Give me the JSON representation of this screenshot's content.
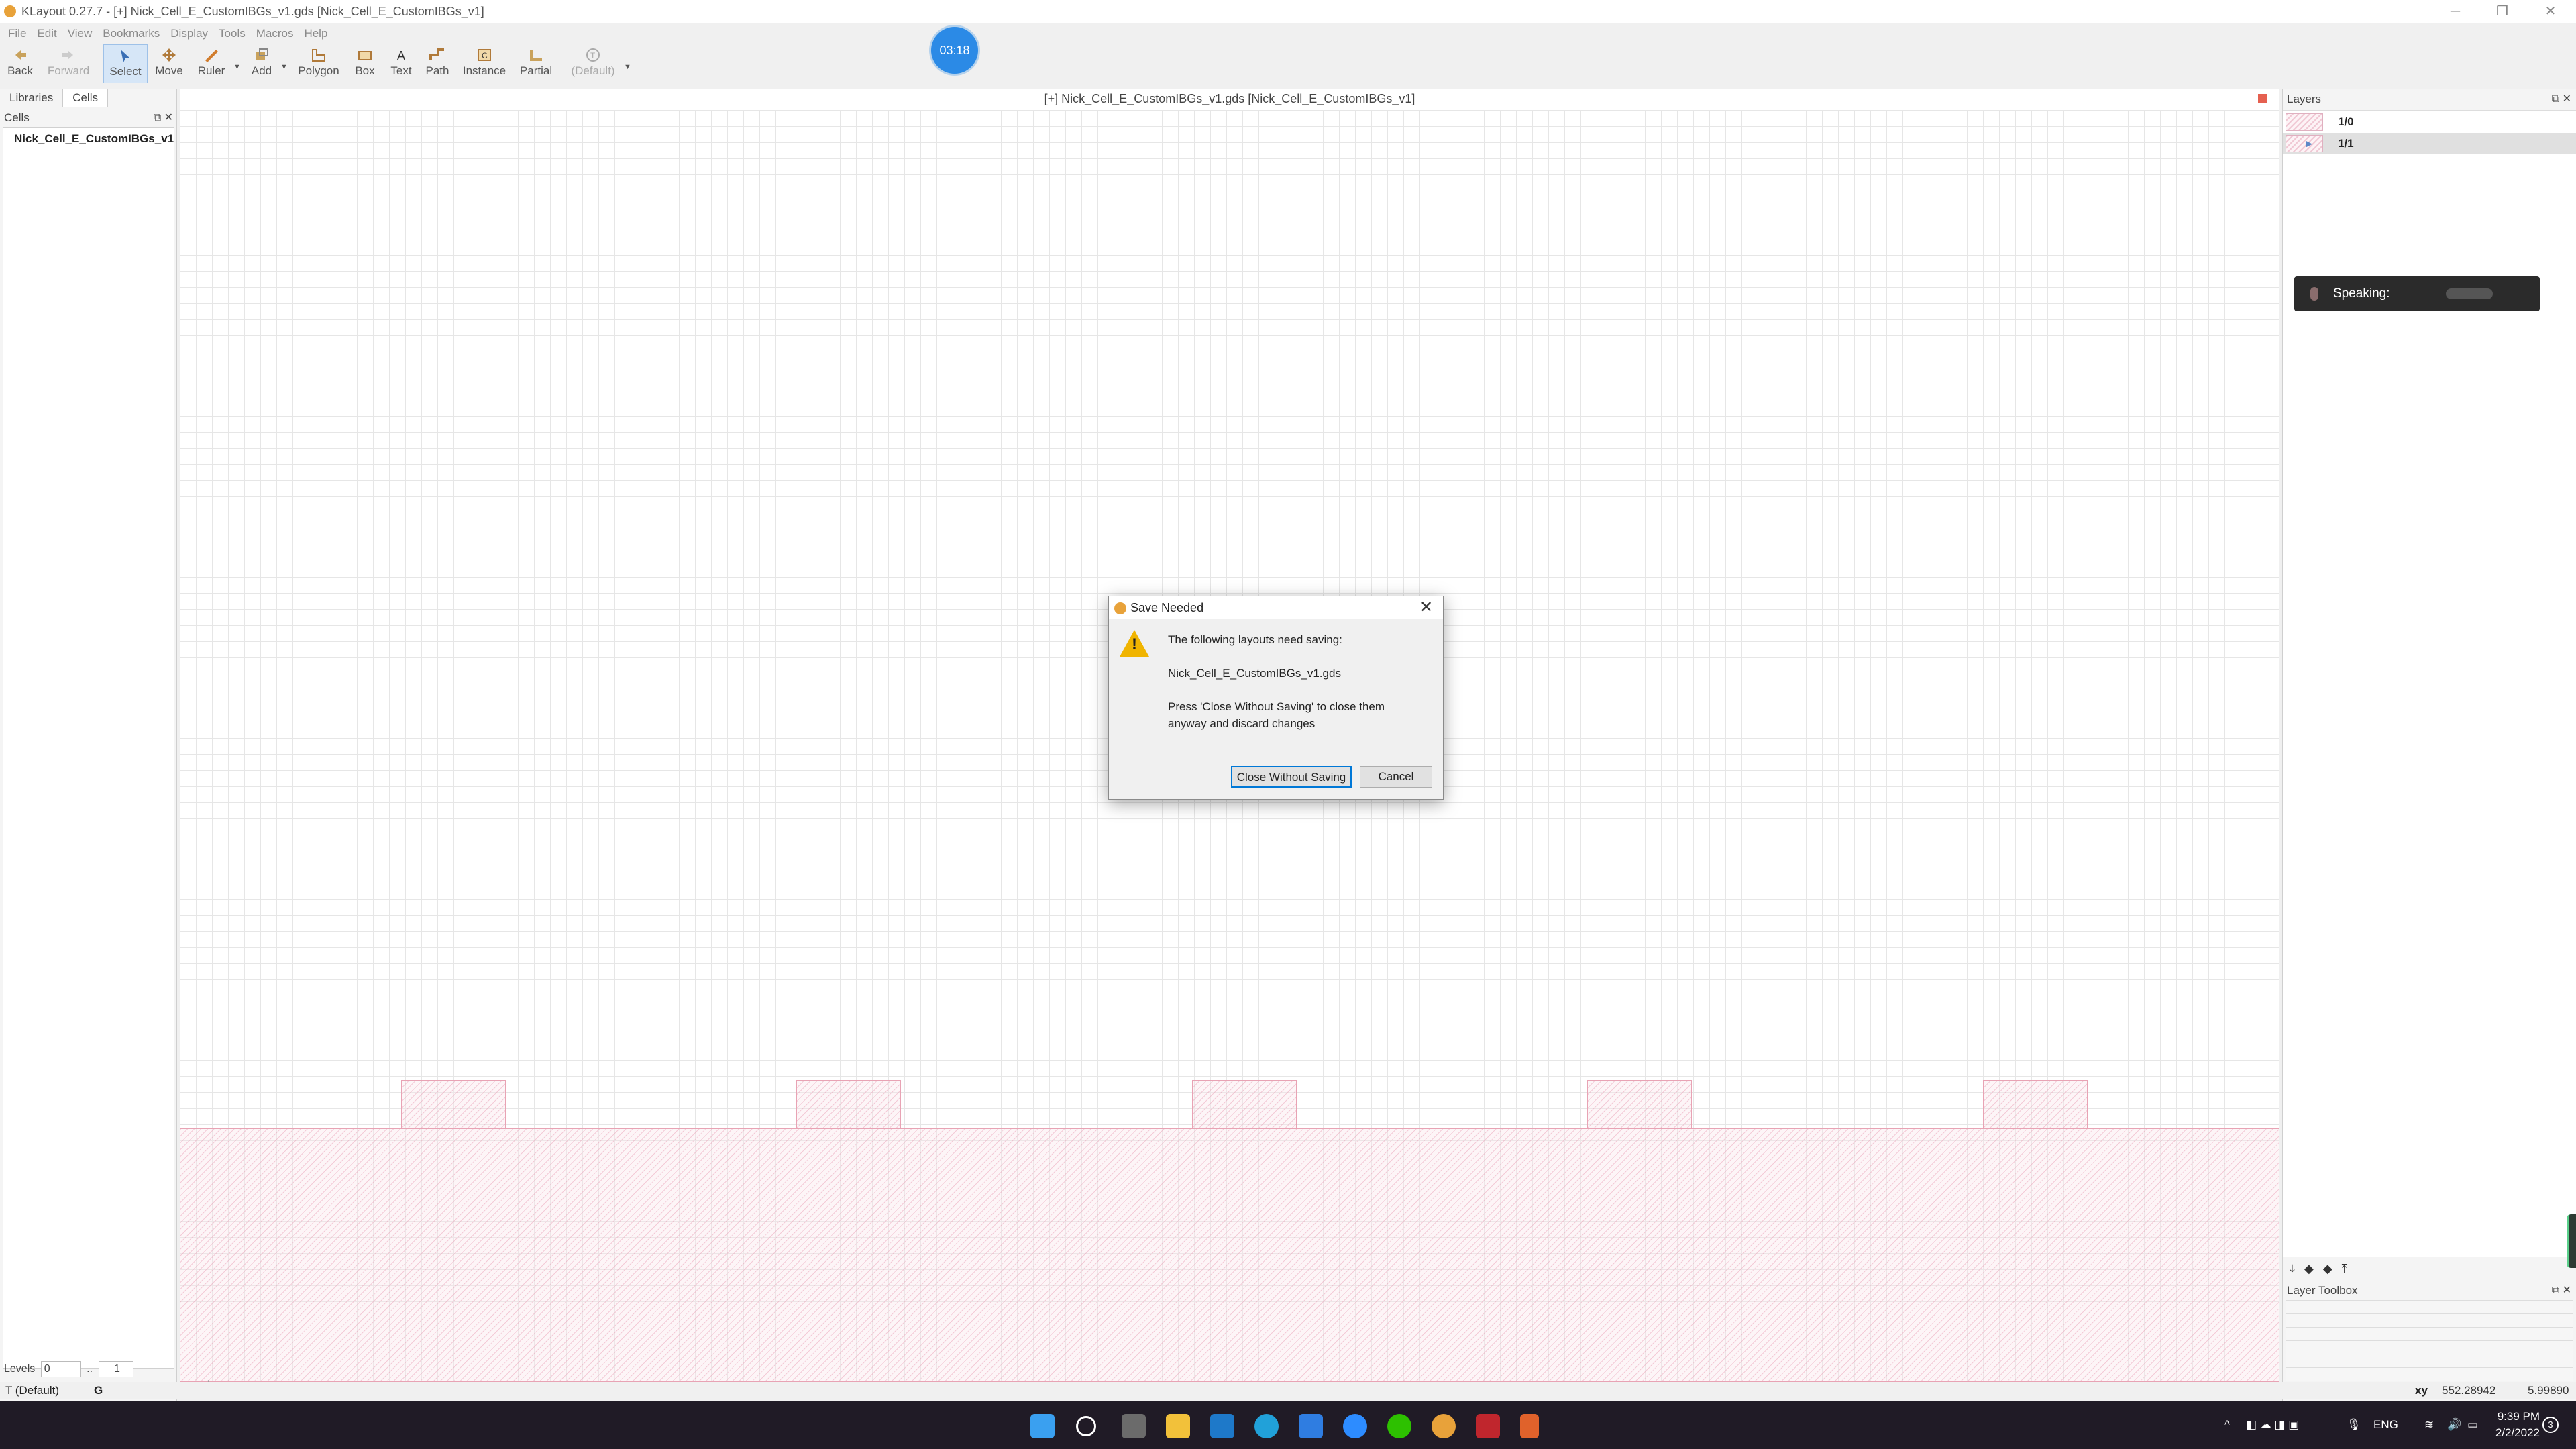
{
  "window": {
    "title": "KLayout 0.27.7 - [+] Nick_Cell_E_CustomIBGs_v1.gds [Nick_Cell_E_CustomIBGs_v1]",
    "minimize": "─",
    "maximize": "❐",
    "close": "✕"
  },
  "menu": [
    "File",
    "Edit",
    "View",
    "Bookmarks",
    "Display",
    "Tools",
    "Macros",
    "Help"
  ],
  "toolbar": {
    "back": "Back",
    "forward": "Forward",
    "select": "Select",
    "move": "Move",
    "ruler": "Ruler",
    "add": "Add",
    "polygon": "Polygon",
    "box": "Box",
    "text": "Text",
    "path": "Path",
    "instance": "Instance",
    "partial": "Partial",
    "default": "(Default)"
  },
  "timer": "03:18",
  "left_panel": {
    "tabs": [
      "Libraries",
      "Cells"
    ],
    "active_tab": "Cells",
    "header": "Cells",
    "cells": [
      "Nick_Cell_E_CustomIBGs_v1"
    ],
    "levels_label": "Levels",
    "levels_min": "0",
    "levels_sep": "..",
    "levels_max": "1"
  },
  "canvas": {
    "title": "[+] Nick_Cell_E_CustomIBGs_v1.gds [Nick_Cell_E_CustomIBGs_v1]"
  },
  "layers_panel": {
    "header": "Layers",
    "layers": [
      {
        "name": "1/0",
        "selected": false
      },
      {
        "name": "1/1",
        "selected": true
      }
    ],
    "toolbox_header": "Layer Toolbox"
  },
  "speaking_overlay": {
    "label": "Speaking:"
  },
  "status_bar": {
    "mode": "T (Default)",
    "grid": "G",
    "xy_label": "xy",
    "x": "552.28942",
    "y": "5.99890"
  },
  "dialog": {
    "title": "Save Needed",
    "line1": "The following layouts need saving:",
    "filename": "Nick_Cell_E_CustomIBGs_v1.gds",
    "line3": "Press 'Close Without Saving' to close them",
    "line4": "anyway and discard changes",
    "close_without_saving": "Close Without Saving",
    "cancel": "Cancel"
  },
  "taskbar": {
    "language": "ENG",
    "time": "9:39 PM",
    "date": "2/2/2022",
    "notifications": "3"
  },
  "colors": {
    "accent": "#0078d7",
    "timer": "#2b8ae6",
    "layer_fill": "#e896af",
    "taskbar": "#201b26"
  }
}
